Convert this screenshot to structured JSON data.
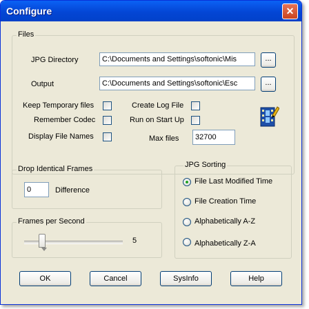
{
  "window": {
    "title": "Configure",
    "close_glyph": "✕"
  },
  "files": {
    "group_label": "Files",
    "jpg_directory": {
      "label": "JPG Directory",
      "value": "C:\\Documents and Settings\\softonic\\Mis",
      "browse_label": "..."
    },
    "output": {
      "label": "Output",
      "value": "C:\\Documents and Settings\\softonic\\Esc",
      "browse_label": "..."
    },
    "keep_temporary_files": {
      "label": "Keep Temporary files",
      "checked": false
    },
    "remember_codec": {
      "label": "Remember Codec",
      "checked": false
    },
    "display_file_names": {
      "label": "Display File Names",
      "checked": false
    },
    "create_log_file": {
      "label": "Create Log File",
      "checked": false
    },
    "run_on_start_up": {
      "label": "Run on Start Up",
      "checked": false
    },
    "max_files": {
      "label": "Max files",
      "value": "32700"
    },
    "icon": "film-pencil-icon"
  },
  "drop_identical_frames": {
    "group_label": "Drop Identical Frames",
    "value": "0",
    "suffix": "Difference"
  },
  "frames_per_second": {
    "group_label": "Frames per Second",
    "value": "5",
    "slider_fraction": 0.25
  },
  "jpg_sorting": {
    "group_label": "JPG Sorting",
    "options": [
      "File Last Modified Time",
      "File Creation Time",
      "Alphabetically A-Z",
      "Alphabetically Z-A"
    ],
    "selected": "File Last Modified Time"
  },
  "buttons": {
    "ok": "OK",
    "cancel": "Cancel",
    "sysinfo": "SysInfo",
    "help": "Help"
  },
  "colors": {
    "titlebar": "#0a58e8",
    "face": "#ece9d8",
    "radio_dot": "#21a121"
  }
}
